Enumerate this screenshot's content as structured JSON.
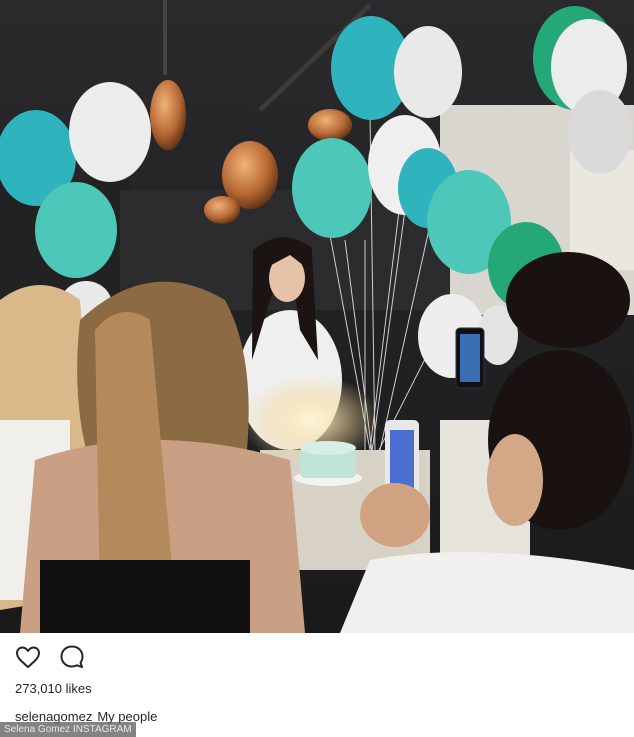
{
  "post": {
    "likes_text": "273,010 likes",
    "username": "selenagomez",
    "caption": "My people",
    "like_icon": "heart-outline-icon",
    "comment_icon": "comment-bubble-icon"
  },
  "overlay": {
    "credit": "Selena Gomez INSTAGRAM"
  },
  "colors": {
    "text": "#262626",
    "teal_balloon": "#2fb3bd",
    "mint_balloon": "#4cc7b8",
    "white_balloon": "#ececec",
    "green_balloon": "#24a878"
  }
}
